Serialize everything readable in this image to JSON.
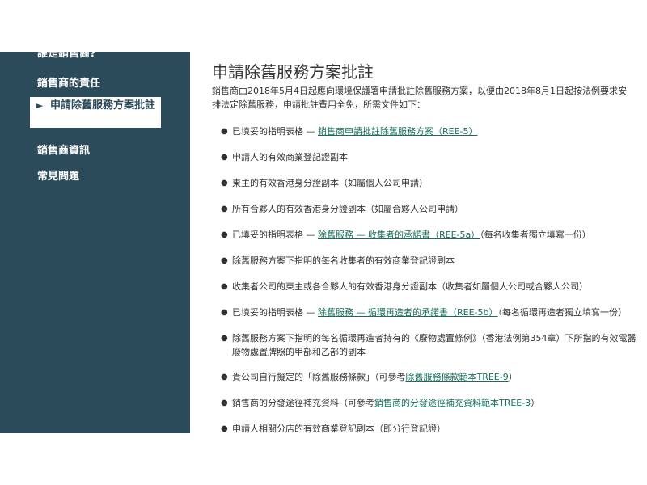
{
  "sidebar": {
    "items": [
      {
        "label": "誰是銷售商?"
      },
      {
        "label": "銷售商的責任"
      },
      {
        "label": "申請除舊服務方案批註",
        "active": true,
        "marker": "►"
      },
      {
        "label": "銷售商資訊"
      },
      {
        "label": "常見問題"
      }
    ]
  },
  "main": {
    "title": "申請除舊服務方案批註",
    "intro": "銷售商由2018年5月4日起應向環境保護署申請批註除舊服務方案，以便由2018年8月1日起按法例要求安排法定除舊服務，申請批註費用全免，所需文件如下：",
    "bullet": "●",
    "documents": [
      {
        "pre": "已填妥的指明表格 — ",
        "link": "銷售商申請批註除舊服務方案（REE-5）",
        "post": ""
      },
      {
        "pre": "申請人的有效商業登記證副本",
        "link": "",
        "post": ""
      },
      {
        "pre": "東主的有效香港身分證副本（如屬個人公司申請）",
        "link": "",
        "post": ""
      },
      {
        "pre": "所有合夥人的有效香港身分證副本（如屬合夥人公司申請）",
        "link": "",
        "post": ""
      },
      {
        "pre": "已填妥的指明表格 — ",
        "link": "除舊服務 — 收集者的承諾書（REE-5a）",
        "post": "（每名收集者獨立填寫一份）"
      },
      {
        "pre": "除舊服務方案下指明的每名收集者的有效商業登記證副本",
        "link": "",
        "post": ""
      },
      {
        "pre": "收集者公司的東主或各合夥人的有效香港身分證副本（收集者如屬個人公司或合夥人公司）",
        "link": "",
        "post": ""
      },
      {
        "pre": "已填妥的指明表格 — ",
        "link": "除舊服務 — 循環再造者的承諾書（REE-5b）",
        "post": "（每名循環再造者獨立填寫一份）"
      },
      {
        "pre": "除舊服務方案下指明的每名循環再造者持有的《廢物處置條例》（香港法例第354章）下所指的有效電器廢物處置牌照的甲部和乙部的副本",
        "link": "",
        "post": ""
      },
      {
        "pre": "貴公司自行擬定的「除舊服務條款」（可參考",
        "link": "除舊服務條款範本TREE-9",
        "post": "）"
      },
      {
        "pre": "銷售商的分發途徑補充資料（可參考",
        "link": "銷售商的分發途徑補充資料範本TREE-3",
        "post": "）"
      },
      {
        "pre": "申請人相關分店的有效商業登記副本（即分行登記證）",
        "link": "",
        "post": ""
      }
    ]
  }
}
